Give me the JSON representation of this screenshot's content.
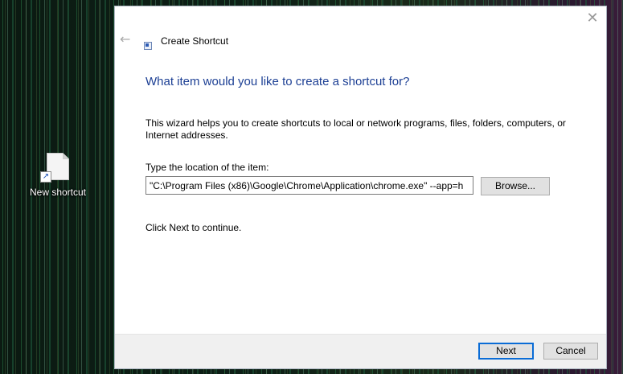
{
  "desktop": {
    "icon_label": "New shortcut",
    "icon_name": "shortcut-file-icon"
  },
  "dialog": {
    "title": "Create Shortcut",
    "close_glyph": "✕",
    "back_glyph": "←",
    "heading": "What item would you like to create a shortcut for?",
    "description": "This wizard helps you to create shortcuts to local or network programs, files, folders, computers, or Internet addresses.",
    "location_label": "Type the location of the item:",
    "location_value": "\"C:\\Program Files (x86)\\Google\\Chrome\\Application\\chrome.exe\" --app=h",
    "browse_label": "Browse...",
    "continue_text": "Click Next to continue.",
    "next_label": "Next",
    "cancel_label": "Cancel"
  },
  "colors": {
    "heading": "#1c3f94",
    "focus_border": "#0a6cd6",
    "button_face": "#e1e1e1",
    "footer": "#f0f0f0"
  }
}
